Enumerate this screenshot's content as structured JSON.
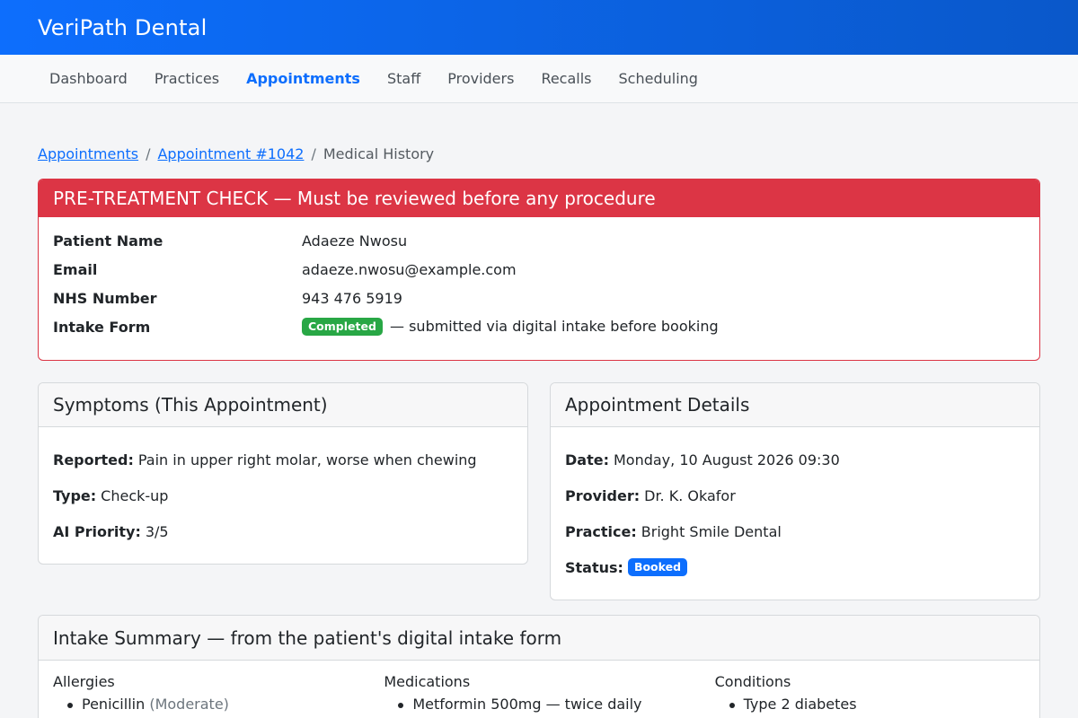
{
  "app": {
    "brand": "VeriPath Dental"
  },
  "nav": {
    "items": [
      {
        "label": "Dashboard",
        "active": false
      },
      {
        "label": "Practices",
        "active": false
      },
      {
        "label": "Appointments",
        "active": true
      },
      {
        "label": "Staff",
        "active": false
      },
      {
        "label": "Providers",
        "active": false
      },
      {
        "label": "Recalls",
        "active": false
      },
      {
        "label": "Scheduling",
        "active": false
      }
    ]
  },
  "breadcrumb": {
    "first": "Appointments",
    "second": "Appointment #1042",
    "current": "Medical History",
    "separator": "/"
  },
  "pretreatment": {
    "title": "PRE-TREATMENT CHECK — Must be reviewed before any procedure",
    "patient_name_label": "Patient Name",
    "patient_name": "Adaeze Nwosu",
    "email_label": "Email",
    "email": "adaeze.nwosu@example.com",
    "nhs_label": "NHS Number",
    "nhs": "943 476 5919",
    "intake_label": "Intake Form",
    "intake_badge": "Completed",
    "intake_note": "— submitted via digital intake before booking"
  },
  "symptoms": {
    "title": "Symptoms (This Appointment)",
    "reported_label": "Reported:",
    "reported": "Pain in upper right molar, worse when chewing",
    "type_label": "Type:",
    "type": "Check-up",
    "priority_label": "AI Priority:",
    "priority": "3/5"
  },
  "appointment": {
    "title": "Appointment Details",
    "date_label": "Date:",
    "date": "Monday, 10 August 2026 09:30",
    "provider_label": "Provider:",
    "provider": "Dr. K. Okafor",
    "practice_label": "Practice:",
    "practice": "Bright Smile Dental",
    "status_label": "Status:",
    "status": "Booked"
  },
  "intake": {
    "title": "Intake Summary — from the patient's digital intake form",
    "allergies_title": "Allergies",
    "allergy_1": "Penicillin",
    "allergy_1_severity": "(Moderate)",
    "medications_title": "Medications",
    "medication_1": "Metformin 500mg — twice daily",
    "conditions_title": "Conditions",
    "condition_1": "Type 2 diabetes"
  },
  "colors": {
    "brand_blue": "#0d6efd",
    "alert_red": "#dc3545",
    "success_green": "#28a745"
  }
}
